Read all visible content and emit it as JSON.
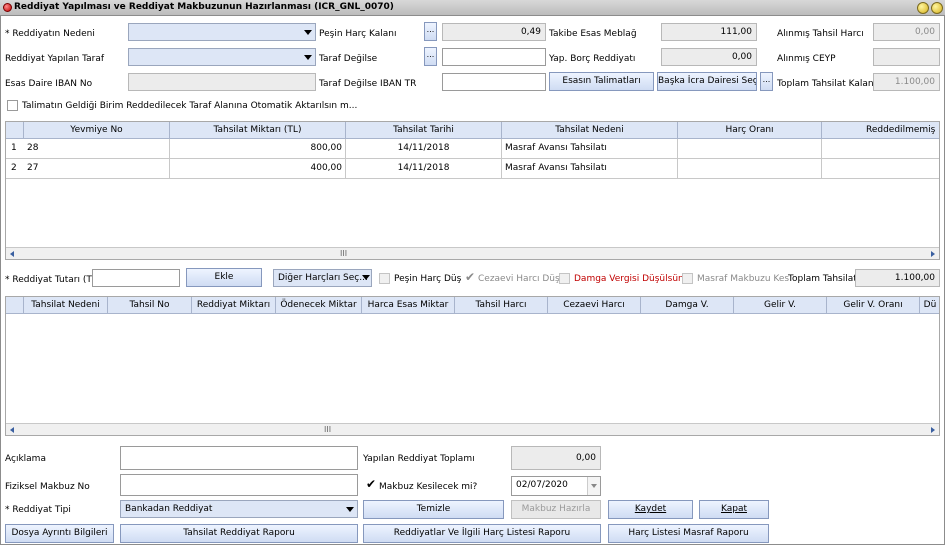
{
  "window": {
    "title": "Reddiyat Yapılması ve Reddiyat Makbuzunun Hazırlanması (ICR_GNL_0070)"
  },
  "top": {
    "reddiyat_nedeni_label": "* Reddiyatın Nedeni",
    "reddiyat_yapilan_taraf_label": "Reddiyat Yapılan Taraf",
    "esas_daire_iban_label": "Esas Daire IBAN No",
    "pesin_harc_kalani_label": "Peşin Harç Kalanı",
    "pesin_harc_kalani_value": "0,49",
    "taraf_degilse_label": "Taraf Değilse",
    "taraf_degilse_iban_label": "Taraf Değilse IBAN TR",
    "takibe_esas_meblag_label": "Takibe Esas Meblağ",
    "takibe_esas_meblag_value": "111,00",
    "yap_borc_reddiyati_label": "Yap. Borç Reddiyatı",
    "yap_borc_reddiyati_value": "0,00",
    "alinmis_tahsil_harci_label": "Alınmış Tahsil Harcı",
    "alinmis_tahsil_harci_value": "0,00",
    "alinmis_ceyp_label": "Alınmış CEYP",
    "toplam_tahsilat_kalani_label": "Toplam Tahsilat Kalanı",
    "toplam_tahsilat_kalani_value": "1.100,00",
    "esasin_talimatlari_button": "Esasın Talimatları",
    "baska_icra_dairesi_button": "Başka İcra Dairesi Seç",
    "ellipsis": "...",
    "talimat_checkbox_label": "Talimatın Geldiği Birim Reddedilecek Taraf Alanına Otomatik Aktarılsın m..."
  },
  "table1": {
    "columns": [
      "Yevmiye No",
      "Tahsilat Miktarı (TL)",
      "Tahsilat Tarihi",
      "Tahsilat Nedeni",
      "Harç Oranı",
      "Reddedilmemiş M"
    ],
    "rows": [
      {
        "idx": "1",
        "yevmiye": "28",
        "miktar": "800,00",
        "tarih": "14/11/2018",
        "neden": "Masraf Avansı Tahsilatı"
      },
      {
        "idx": "2",
        "yevmiye": "27",
        "miktar": "400,00",
        "tarih": "14/11/2018",
        "neden": "Masraf Avansı Tahsilatı"
      }
    ],
    "grip": "III"
  },
  "middle": {
    "reddiyat_tutari_label": "* Reddiyat Tutarı (TL)",
    "ekle_button": "Ekle",
    "diger_harclari_sec": "Diğer Harçları Seç...",
    "pesin_harc_dus_label": "Peşin Harç Düş",
    "cezaevi_harci_dus_label": "Cezaevi Harcı Düş",
    "damga_vergisi_label": "Damga Vergisi Düşülsün",
    "masraf_makbuzu_label": "Masraf Makbuzu Kes",
    "toplam_tahsilat_label": "Toplam Tahsilat",
    "toplam_tahsilat_value": "1.100,00"
  },
  "table2": {
    "columns": [
      "Tahsilat Nedeni",
      "Tahsil No",
      "Reddiyat Miktarı",
      "Ödenecek Miktar",
      "Harca Esas Miktar",
      "Tahsil Harcı",
      "Cezaevi Harcı",
      "Damga V.",
      "Gelir V.",
      "Gelir V. Oranı",
      "Dü"
    ],
    "grip": "III"
  },
  "bottom": {
    "aciklama_label": "Açıklama",
    "fiziksel_makbuz_label": "Fiziksel Makbuz No",
    "reddiyat_tipi_label": "* Reddiyat Tipi",
    "reddiyat_tipi_value": "Bankadan Reddiyat",
    "yapilan_reddiyat_toplami_label": "Yapılan Reddiyat Toplamı",
    "yapilan_reddiyat_toplami_value": "0,00",
    "makbuz_kesilecek_label": "Makbuz Kesilecek mi?",
    "makbuz_date": "02/07/2020",
    "temizle_button": "Temizle",
    "makbuz_hazirla_button": "Makbuz Hazırla",
    "kaydet_button": "Kaydet",
    "kapat_button": "Kapat",
    "dosya_ayrinti_button": "Dosya Ayrıntı Bilgileri",
    "tahsilat_reddiyat_raporu_button": "Tahsilat Reddiyat Raporu",
    "reddiyatlar_harc_listesi_button": "Reddiyatlar Ve İlgili Harç Listesi Raporu",
    "harc_listesi_masraf_button": "Harç Listesi Masraf Raporu"
  },
  "colors": {
    "accent": "#dde6f6",
    "button": "#cfdcf3",
    "red_label": "#c00000"
  }
}
